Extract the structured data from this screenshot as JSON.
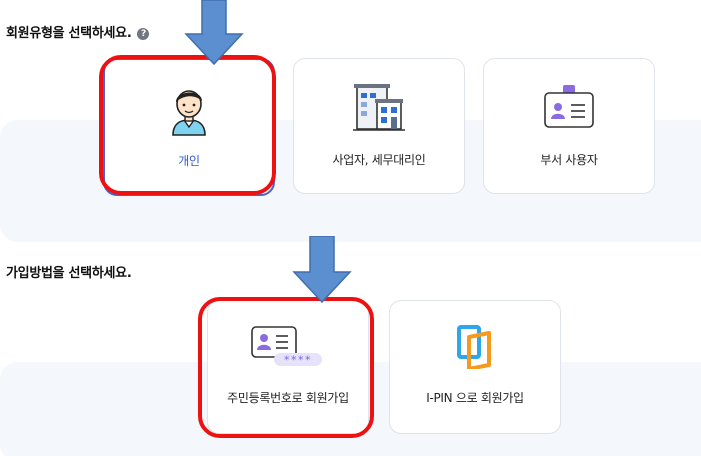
{
  "sections": {
    "member_type_title": "회원유형을 선택하세요.",
    "help_icon_glyph": "?",
    "join_method_title": "가입방법을 선택하세요."
  },
  "member_types": {
    "personal": "개인",
    "business": "사업자, 세무대리인",
    "department": "부서 사용자"
  },
  "join_methods": {
    "rrn": "주민등록번호로 회원가입",
    "rrn_mask": "****",
    "ipin": "I-PIN 으로 회원가입"
  },
  "colors": {
    "accent_blue": "#2f5bd3",
    "highlight_red": "#ee1111",
    "arrow_blue": "#5b8fd0",
    "band_bg": "#f4f7fc"
  },
  "icons": {
    "personal": "person-avatar-icon",
    "business": "office-building-icon",
    "department": "id-badge-icon",
    "rrn": "id-card-masked-icon",
    "ipin": "ipin-logo-icon",
    "help": "help-icon"
  }
}
